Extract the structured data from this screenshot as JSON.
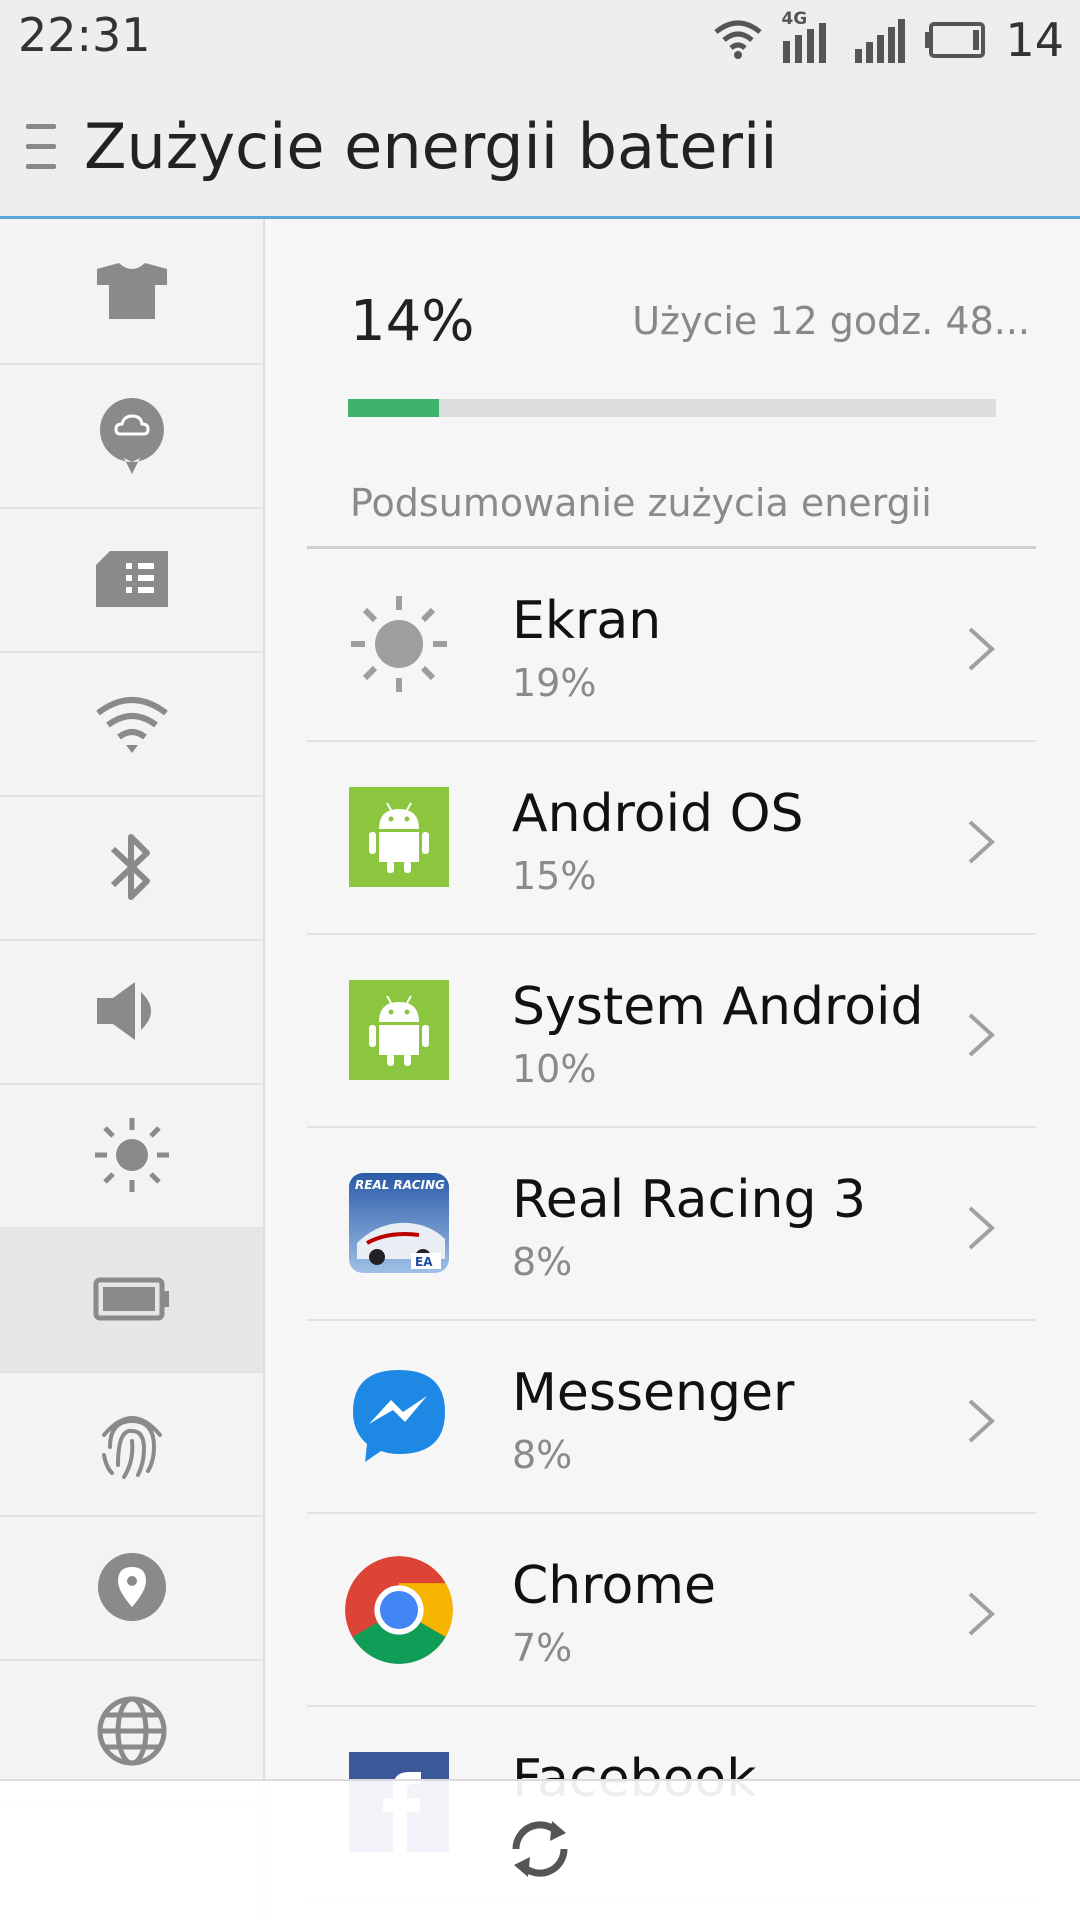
{
  "status_bar": {
    "time": "22:31",
    "network_label": "4G",
    "battery": "14"
  },
  "header": {
    "title": "Zużycie energii baterii"
  },
  "sidebar": {
    "items": [
      {
        "icon": "theme-shirt-icon"
      },
      {
        "icon": "cloud-sync-icon"
      },
      {
        "icon": "sim-card-icon"
      },
      {
        "icon": "wifi-icon"
      },
      {
        "icon": "bluetooth-icon"
      },
      {
        "icon": "sound-icon"
      },
      {
        "icon": "brightness-icon"
      },
      {
        "icon": "battery-icon",
        "active": true
      },
      {
        "icon": "fingerprint-icon"
      },
      {
        "icon": "location-icon"
      },
      {
        "icon": "globe-icon"
      }
    ]
  },
  "battery": {
    "percent": "14%",
    "level": 0.14,
    "usage_time": "Użycie 12 godz. 48..."
  },
  "summary": {
    "title": "Podsumowanie zużycia energii"
  },
  "apps": [
    {
      "name": "Ekran",
      "percent": "19%",
      "icon": "sun-icon"
    },
    {
      "name": "Android OS",
      "percent": "15%",
      "icon": "android-icon"
    },
    {
      "name": "System Android",
      "percent": "10%",
      "icon": "android-icon"
    },
    {
      "name": "Real Racing 3",
      "percent": "8%",
      "icon": "real-racing-icon",
      "icon_text": "REAL RACING",
      "icon_badge": "EA"
    },
    {
      "name": "Messenger",
      "percent": "8%",
      "icon": "messenger-icon"
    },
    {
      "name": "Chrome",
      "percent": "7%",
      "icon": "chrome-icon"
    },
    {
      "name": "Facebook",
      "percent": "",
      "icon": "facebook-icon"
    }
  ],
  "colors": {
    "accent_line": "#5aa6d8",
    "progress_fill": "#3db36b",
    "android_green": "#8cc63f",
    "messenger_blue": "#1e88e5"
  }
}
